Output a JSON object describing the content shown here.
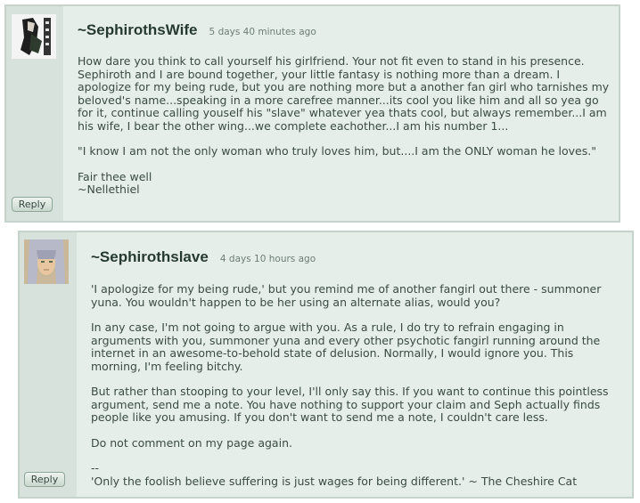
{
  "comments": [
    {
      "username": "~SephirothsWife",
      "time": "5 days 40 minutes ago",
      "reply_label": "Reply",
      "paragraphs": [
        "How dare you think to call yourself his girlfriend. Your not fit even to stand in his presence. Sephiroth and I are bound together, your little fantasy is nothing more than a dream. I apologize for my being rude, but you are nothing more but a another fan girl who tarnishes my beloved's name...speaking in a more carefree manner...its cool you like him and all so yea go for it, continue calling youself his \"slave\" whatever yea thats cool, but always remember...I am his wife, I bear the other wing...we complete eachother...I am his number 1...",
        "\"I know I am not the only woman who truly loves him, but....I am the ONLY woman he loves.\"",
        "Fair thee well\n~Nellethiel"
      ]
    },
    {
      "username": "~Sephirothslave",
      "time": "4 days 10 hours ago",
      "reply_label": "Reply",
      "paragraphs": [
        "'I apologize for my being rude,' but you remind me of another fangirl out there - summoner yuna. You wouldn't happen to be her using an alternate alias, would you?",
        "In any case, I'm not going to argue with you. As a rule, I do try to refrain engaging in arguments with you, summoner yuna and every other psychotic fangirl running around the internet in an awesome-to-behold state of delusion. Normally, I would ignore you. This morning, I'm feeling bitchy.",
        "But rather than stooping to your level, I'll only say this. If you want to continue this pointless argument, send me a note. You have nothing to support your claim and Seph actually finds people like you amusing. If you don't want to send me a note, I couldn't care less.",
        "Do not comment on my page again.",
        "--\n'Only the foolish believe suffering is just wages for being different.' ~ The Cheshire Cat"
      ]
    }
  ]
}
